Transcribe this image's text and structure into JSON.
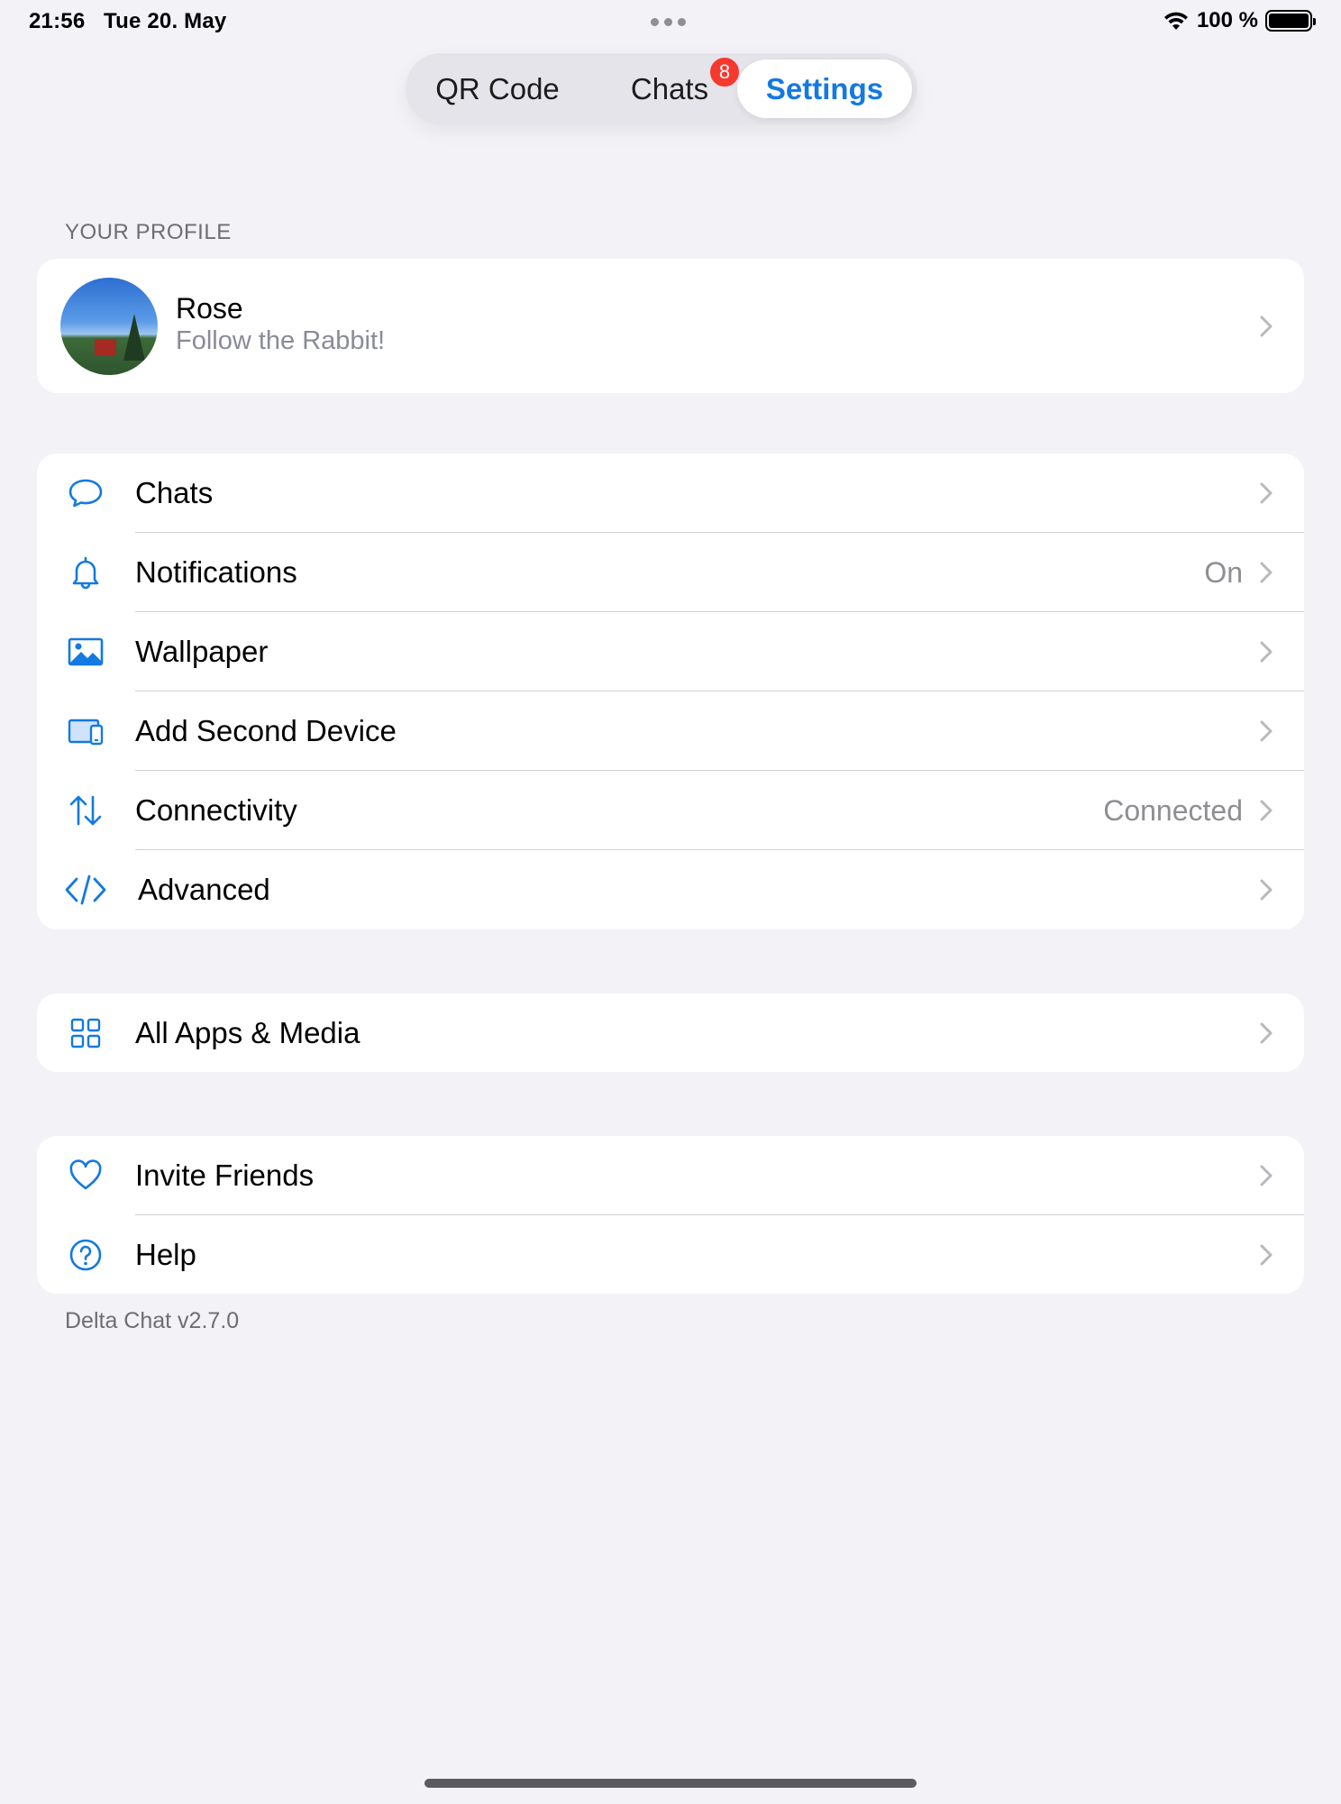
{
  "status_bar": {
    "time": "21:56",
    "date": "Tue 20. May",
    "battery": "100 %",
    "battery_level": 1.0
  },
  "tabs": {
    "qr": "QR Code",
    "chats": "Chats",
    "chats_badge": "8",
    "settings": "Settings"
  },
  "profile": {
    "header": "YOUR PROFILE",
    "name": "Rose",
    "status": "Follow the Rabbit!"
  },
  "settings_group": [
    {
      "label": "Chats",
      "value": "",
      "icon": "chat-bubble-icon"
    },
    {
      "label": "Notifications",
      "value": "On",
      "icon": "bell-icon"
    },
    {
      "label": "Wallpaper",
      "value": "",
      "icon": "photo-icon"
    },
    {
      "label": "Add Second Device",
      "value": "",
      "icon": "devices-icon"
    },
    {
      "label": "Connectivity",
      "value": "Connected",
      "icon": "arrows-up-down-icon"
    },
    {
      "label": "Advanced",
      "value": "",
      "icon": "code-icon"
    }
  ],
  "apps_group": [
    {
      "label": "All Apps & Media",
      "icon": "grid-icon"
    }
  ],
  "help_group": [
    {
      "label": "Invite Friends",
      "icon": "heart-icon"
    },
    {
      "label": "Help",
      "icon": "question-circle-icon"
    }
  ],
  "footer": "Delta Chat v2.7.0",
  "colors": {
    "accent": "#1479e0",
    "badge": "#f5392f",
    "background": "#f2f2f7"
  }
}
